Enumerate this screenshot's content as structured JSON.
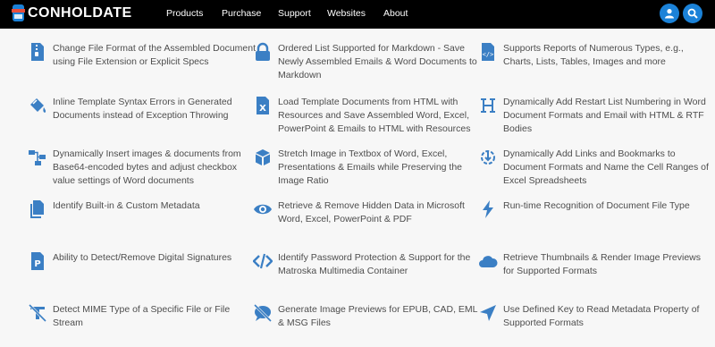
{
  "brand": {
    "name": "CONHOLDATE"
  },
  "nav": {
    "items": [
      "Products",
      "Purchase",
      "Support",
      "Websites",
      "About"
    ]
  },
  "colors": {
    "accent": "#3b7fc4",
    "navbar": "#000000",
    "circle": "#1b82d8"
  },
  "features": [
    {
      "text": "Change File Format of the Assembled Document using File Extension or Explicit Specs",
      "icon": "file-zipper-icon"
    },
    {
      "text": "Ordered List Supported for Markdown - Save Newly Assembled Emails & Word Documents to Markdown",
      "icon": "lock-icon"
    },
    {
      "text": "Supports Reports of Numerous Types, e.g., Charts, Lists, Tables, Images and more",
      "icon": "file-code-icon"
    },
    {
      "text": "Inline Template Syntax Errors in Generated Documents instead of Exception Throwing",
      "icon": "paint-bucket-icon"
    },
    {
      "text": "Load Template Documents from HTML with Resources and Save Assembled Word, Excel, PowerPoint & Emails to HTML with Resources",
      "icon": "file-excel-icon"
    },
    {
      "text": "Dynamically Add Restart List Numbering in Word Document Formats and Email with HTML & RTF Bodies",
      "icon": "heading-icon"
    },
    {
      "text": "Dynamically Insert images & documents from Base64-encoded bytes and adjust checkbox value settings of Word documents",
      "icon": "sitemap-icon"
    },
    {
      "text": "Stretch Image in Textbox of Word, Excel, Presentations & Emails while Preserving the Image Ratio",
      "icon": "cube-icon"
    },
    {
      "text": "Dynamically Add Links and Bookmarks to Document Formats and Name the Cell Ranges of Excel Spreadsheets",
      "icon": "link-bookmark-icon"
    },
    {
      "text": "Identify Built-in & Custom Metadata",
      "icon": "copy-icon"
    },
    {
      "text": "Retrieve & Remove Hidden Data in Microsoft Word, Excel, PowerPoint & PDF",
      "icon": "eye-icon"
    },
    {
      "text": "Run-time Recognition of Document File Type",
      "icon": "bolt-icon"
    },
    {
      "text": "Ability to Detect/Remove Digital Signatures",
      "icon": "file-powerpoint-icon"
    },
    {
      "text": "Identify Password Protection & Support for the Matroska Multimedia Container",
      "icon": "code-icon"
    },
    {
      "text": "Retrieve Thumbnails & Render Image Previews for Supported Formats",
      "icon": "cloud-icon"
    },
    {
      "text": "Detect MIME Type of a Specific File or File Stream",
      "icon": "text-slash-icon"
    },
    {
      "text": "Generate Image Previews for EPUB, CAD, EML & MSG Files",
      "icon": "comment-slash-icon"
    },
    {
      "text": "Use Defined Key to Read Metadata Property of Supported Formats",
      "icon": "location-arrow-icon"
    }
  ]
}
